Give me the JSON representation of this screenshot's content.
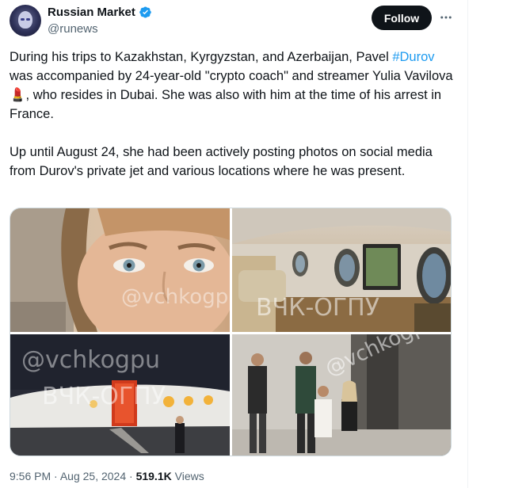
{
  "account": {
    "name": "Russian Market",
    "handle": "@runews",
    "verified": true,
    "avatar_icon": "avatar-icon"
  },
  "actions": {
    "follow_label": "Follow",
    "more_icon": "more-icon"
  },
  "tweet": {
    "text_a": "During his trips to Kazakhstan, Kyrgyzstan, and Azerbaijan, Pavel ",
    "hashtag": "#Durov",
    "text_b": " was accompanied by 24-year-old \"crypto coach\" and streamer Yulia Vavilova 💄, who resides in Dubai. She was also with him at the time of his arrest in France.\n\nUp until August 24, she had been actively posting photos on social media from Durov's private jet and various locations where he was present."
  },
  "media": {
    "watermarks": [
      "@vchkogpu",
      "ВЧК-ОГПУ",
      "@vchkogpu",
      "ВЧК-ОГПУ",
      "@vchkogpu"
    ]
  },
  "meta": {
    "time": "9:56 PM",
    "date": "Aug 25, 2024",
    "views_count": "519.1K",
    "views_label": "Views",
    "separator": "·"
  },
  "colors": {
    "link": "#1d9bf0",
    "verified_badge": "#1d9bf0",
    "follow_bg": "#0f1419",
    "secondary_text": "#536471"
  }
}
